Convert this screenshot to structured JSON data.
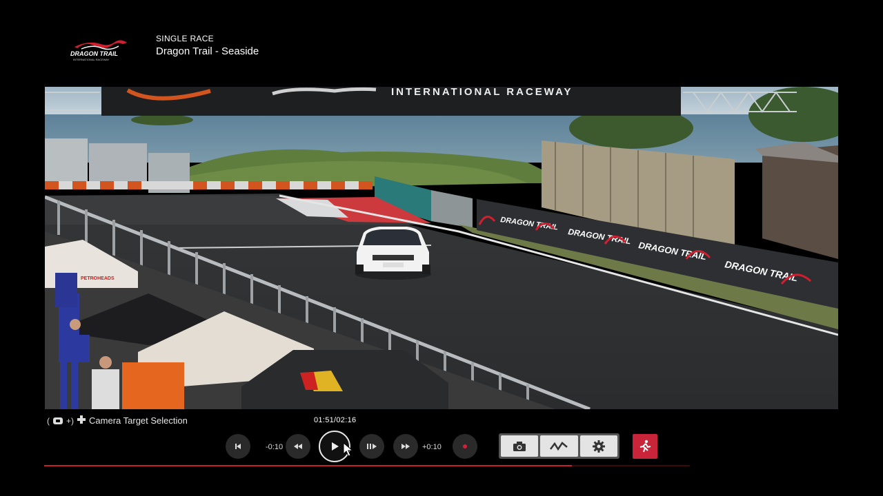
{
  "header": {
    "mode": "SINGLE RACE",
    "track": "Dragon Trail - Seaside",
    "logo_main": "DRAGON TRAIL",
    "logo_sub": "INTERNATIONAL RACEWAY"
  },
  "scene": {
    "banner_text": "INTERNATIONAL RACEWAY",
    "barrier_logo": "DRAGON TRAIL",
    "barrier_sub": "INTERNATIONAL RACEWAY",
    "tent_text": "PETROHEADS"
  },
  "controls": {
    "camera_hint": "Camera Target Selection",
    "time_readout": "01:51/02:16",
    "rewind_label": "-0:10",
    "forward_label": "+0:10",
    "progress": 0.817
  },
  "icons": [
    "skip-start-icon",
    "rewind-icon",
    "play-icon",
    "step-forward-icon",
    "fast-forward-icon",
    "record-icon",
    "camera-icon",
    "telemetry-icon",
    "settings-icon",
    "exit-icon"
  ],
  "colors": {
    "accent": "#c71f2e",
    "exit": "#c8243a"
  }
}
